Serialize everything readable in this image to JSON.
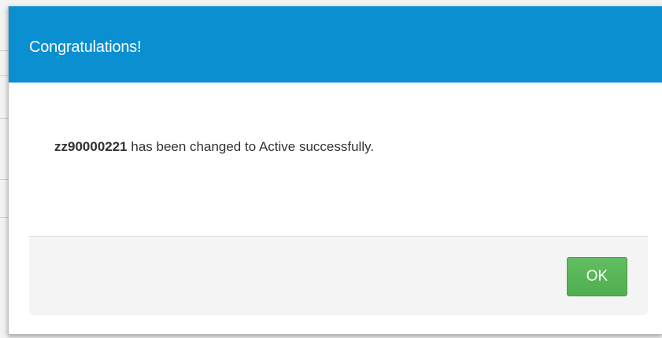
{
  "modal": {
    "title": "Congratulations!",
    "message": {
      "subject": "zz90000221",
      "text": " has been changed to Active successfully."
    },
    "ok_label": "OK"
  },
  "colors": {
    "header": "#0a8fd1",
    "ok_button": "#5cb85c",
    "footer": "#f4f4f4"
  }
}
